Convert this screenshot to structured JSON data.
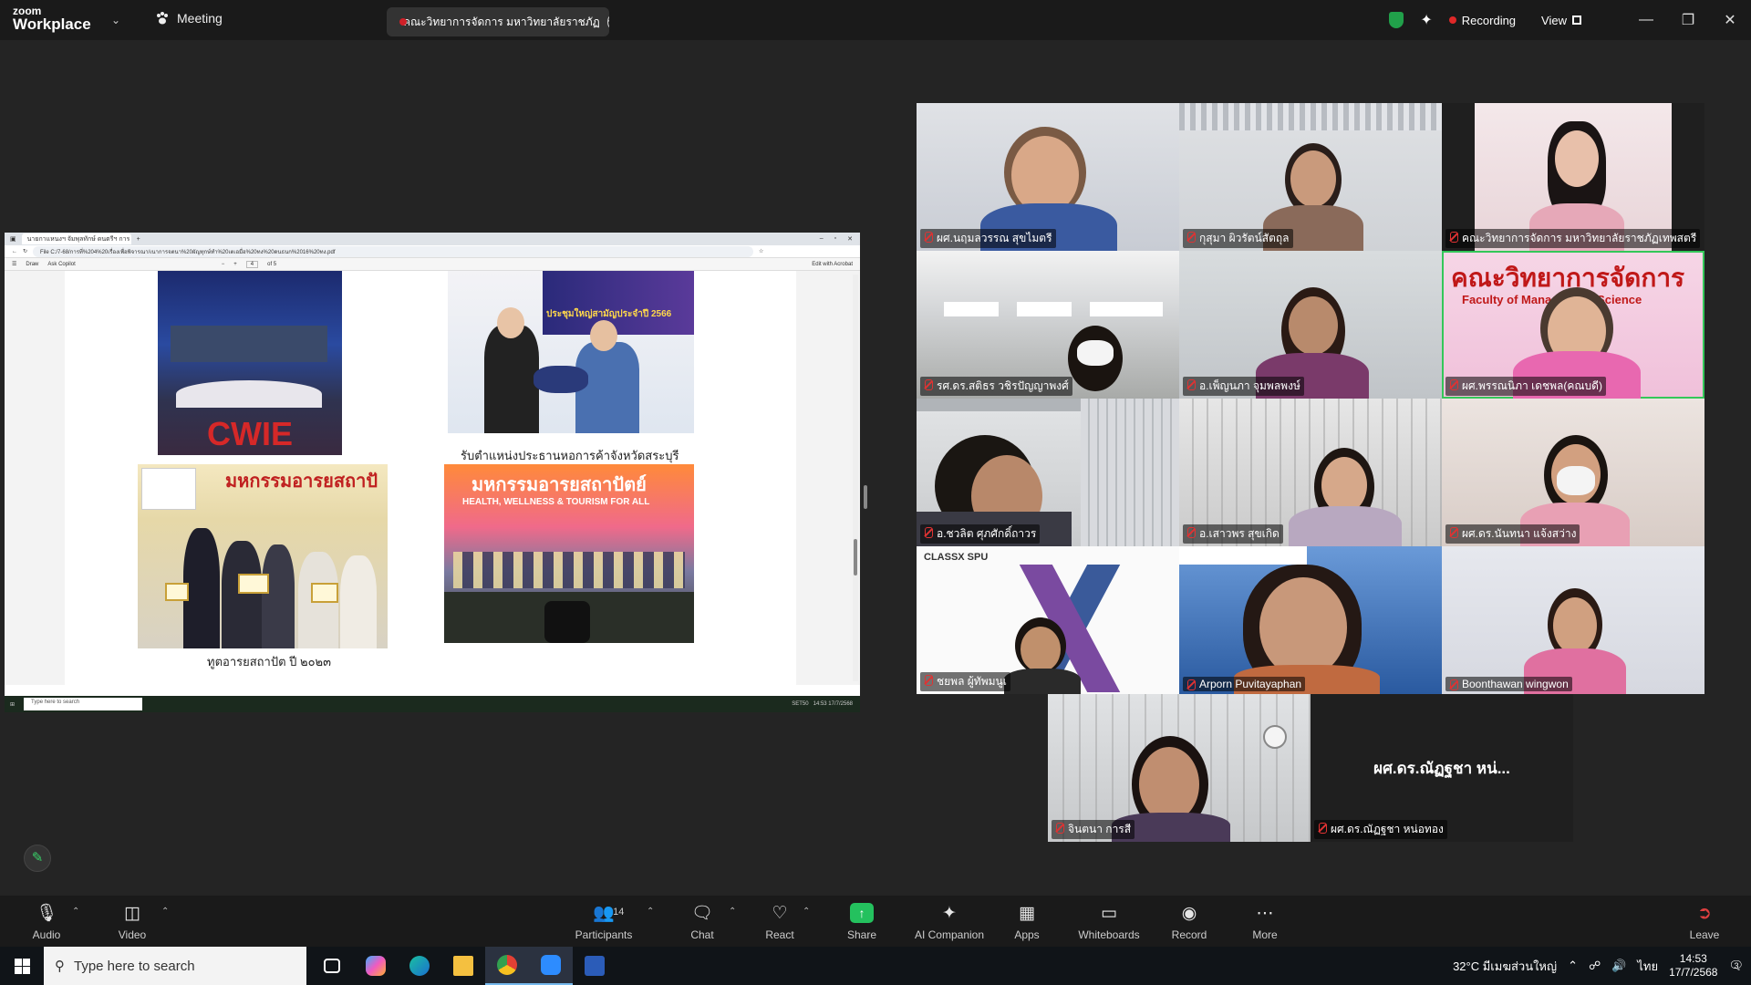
{
  "titlebar": {
    "logo_line1": "zoom",
    "logo_line2": "Workplace",
    "meeting_label": "Meeting",
    "share_tab_label": "คณะวิทยาการจัดการ มหาวิทยาลัยราชภัฏ",
    "recording_label": "Recording",
    "view_label": "View"
  },
  "shared_screen": {
    "browser_tab": "นายกาแหนงฯ จัมพุลทักษ์ ดนตรีฯ การ ดร.",
    "url": "File  C:/7-68/การที่%204%20เรื่องเพื่อพิจารณา/เนาการจตนา%20ผัญทุกษ์ทำ%20เตเอมื่อ%20ทง%20ดนธนก%2016%20ทง.pdf",
    "pdf_tools": [
      "Draw",
      "Ask Copilot"
    ],
    "page_num": "4",
    "page_total": "of 5",
    "edit_acrobat": "Edit with Acrobat",
    "caption1": "รับตำแหน่งประธานหอการค้าจังหวัดสระบุรี",
    "caption2": "ทูตอารยสถาปัต ปี ๒๐๒๓",
    "photo_text_cwie": "CWIE",
    "photo_text_2566": "ประชุมใหญ่สามัญประจำปี 2566",
    "photo_text_expo": "มหกรรมอารยสถาปั",
    "photo_text_health": "HEALTH, WELLNESS & TOURISM FOR ALL",
    "inner_search": "Type here to search",
    "inner_stock": "SET50",
    "inner_time": "14:53",
    "inner_date": "17/7/2568"
  },
  "participants": [
    {
      "name": "ผศ.นฤมลวรรณ สุขไมตรี"
    },
    {
      "name": "กุสุมา ผิวรัตน์สัตถุล"
    },
    {
      "name": "คณะวิทยาการจัดการ มหาวิทยาลัยราชภัฏเทพสตรี"
    },
    {
      "name": "รศ.ดร.สติธร วชิรปัญญาพงศ์"
    },
    {
      "name": "อ.เพ็ญนภา จุมพลพงษ์"
    },
    {
      "name": "ผศ.พรรณนิภา เดชพล(คณบดี)",
      "bg_text": "คณะวิทยาการจัดการ",
      "bg_text2": "Faculty of Management Science"
    },
    {
      "name": "อ.ชวลิต ศุภศักดิ์ถาวร"
    },
    {
      "name": "อ.เสาวพร สุขเกิด"
    },
    {
      "name": "ผศ.ดร.นันทนา แจ้งสว่าง"
    },
    {
      "name": "ชยพล ผู้ทัพมนูเ",
      "bg_text": "CLASSX SPU"
    },
    {
      "name": "Arporn Puvitayaphan"
    },
    {
      "name": "Boonthawan wingwon"
    },
    {
      "name": "จินตนา การสี"
    },
    {
      "name": "ผศ.ดร.ณัฏฐชา หน่อทอง",
      "video_off_name": "ผศ.ดร.ณัฏฐชา หน่..."
    }
  ],
  "controls": {
    "audio": "Audio",
    "video": "Video",
    "participants": "Participants",
    "participant_count": "14",
    "chat": "Chat",
    "react": "React",
    "share": "Share",
    "ai_companion": "AI Companion",
    "apps": "Apps",
    "whiteboards": "Whiteboards",
    "record": "Record",
    "more": "More",
    "leave": "Leave"
  },
  "taskbar": {
    "search_placeholder": "Type here to search",
    "weather": "32°C  มีเมฆส่วนใหญ่",
    "lang": "ไทย",
    "time": "14:53",
    "date": "17/7/2568",
    "notif_count": "3"
  },
  "colors": {
    "zoom_bg": "#242424",
    "active_speaker": "#34c759",
    "share_green": "#24c15e",
    "recording_red": "#e02828"
  }
}
